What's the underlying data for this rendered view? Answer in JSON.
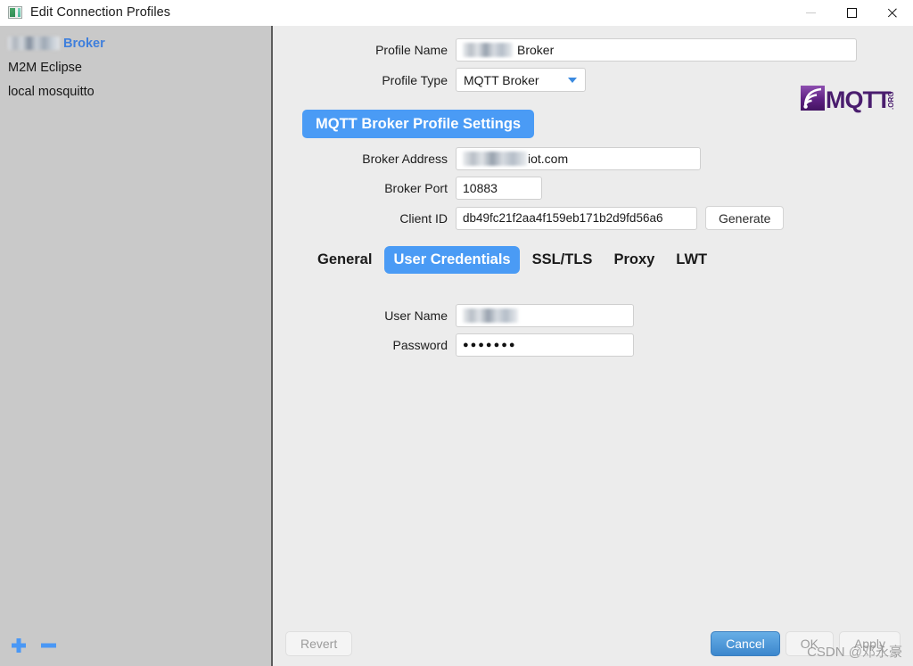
{
  "window": {
    "title": "Edit Connection Profiles",
    "app_icon": "app-window-icon",
    "controls": {
      "minimize": "minimize-icon",
      "maximize": "maximize-icon",
      "close": "close-icon"
    }
  },
  "sidebar": {
    "items": [
      {
        "label": "Broker",
        "redacted_prefix": true,
        "selected": true
      },
      {
        "label": "M2M Eclipse",
        "redacted_prefix": false,
        "selected": false
      },
      {
        "label": "local mosquitto",
        "redacted_prefix": false,
        "selected": false
      }
    ],
    "add_label": "+",
    "remove_label": "−"
  },
  "form": {
    "profile_name_label": "Profile Name",
    "profile_name_value": "Broker",
    "profile_type_label": "Profile Type",
    "profile_type_value": "MQTT Broker",
    "profile_type_options": [
      "MQTT Broker"
    ],
    "logo_alt": "MQTT.ORG",
    "section_title": "MQTT Broker Profile Settings",
    "broker_address_label": "Broker Address",
    "broker_address_value": "iot.com",
    "broker_port_label": "Broker Port",
    "broker_port_value": "10883",
    "client_id_label": "Client ID",
    "client_id_value": "db49fc21f2aa4f159eb171b2d9fd56a6",
    "generate_label": "Generate"
  },
  "tabs": [
    {
      "label": "General",
      "active": false
    },
    {
      "label": "User Credentials",
      "active": true
    },
    {
      "label": "SSL/TLS",
      "active": false
    },
    {
      "label": "Proxy",
      "active": false
    },
    {
      "label": "LWT",
      "active": false
    }
  ],
  "credentials": {
    "user_name_label": "User Name",
    "user_name_value": "",
    "password_label": "Password",
    "password_value": "●●●●●●●"
  },
  "footer": {
    "revert_label": "Revert",
    "cancel_label": "Cancel",
    "ok_label": "OK",
    "apply_label": "Apply"
  },
  "watermark": "CSDN @邓永豪",
  "colors": {
    "accent_blue": "#4a9bf5",
    "primary_button": "#3c87cd",
    "sidebar_bg": "#c9c9c9",
    "panel_bg": "#ececec",
    "selected_item": "#3f7fdc",
    "logo_purple": "#6b2d8f"
  }
}
